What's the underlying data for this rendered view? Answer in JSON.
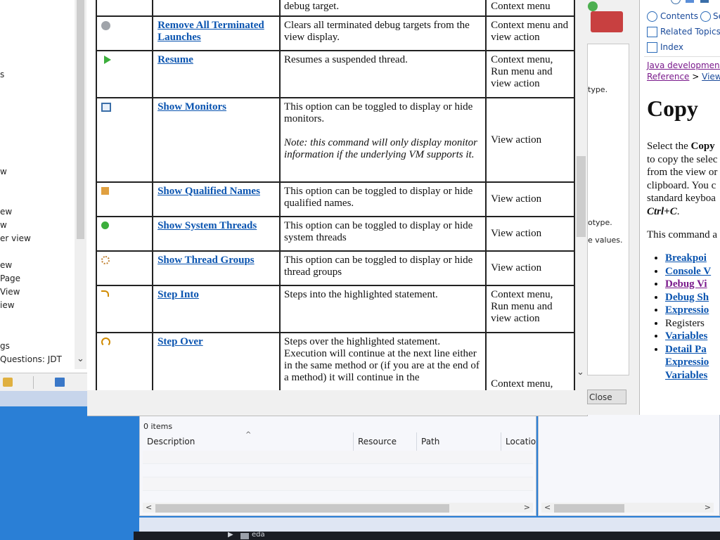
{
  "left_nav": {
    "items": [
      {
        "label": "s"
      },
      {
        "label": "w"
      },
      {
        "label": "ew"
      },
      {
        "label": "w"
      },
      {
        "label": "er view"
      },
      {
        "label": "ew"
      },
      {
        "label": " Page"
      },
      {
        "label": " View"
      },
      {
        "label": "iew"
      },
      {
        "label": "gs"
      },
      {
        "label": "Questions: JDT"
      }
    ]
  },
  "help_table": {
    "rows": [
      {
        "name": "",
        "desc": "debug target.",
        "loc": "Context menu",
        "icon": "launch-icon"
      },
      {
        "name": "Remove All Terminated Launches",
        "desc": "Clears all terminated debug targets from the view display.",
        "loc": "Context menu and view action",
        "icon": "remove-all-icon"
      },
      {
        "name": "Resume",
        "desc": "Resumes a suspended thread.",
        "loc": "Context menu, Run menu and view action",
        "icon": "resume-icon"
      },
      {
        "name": "Show Monitors",
        "desc": "This option can be toggled to display or hide monitors.",
        "note": "Note: this command will only display monitor information if the underlying VM supports it.",
        "loc": "View action",
        "icon": "monitors-icon"
      },
      {
        "name": "Show Qualified Names",
        "desc": "This option can be toggled to display or hide qualified names.",
        "loc": "View action",
        "icon": "qualified-names-icon"
      },
      {
        "name": "Show System Threads",
        "desc": "This option can be toggled to display or hide system threads",
        "loc": "View action",
        "icon": "system-threads-icon"
      },
      {
        "name": "Show Thread Groups",
        "desc": "This option can be toggled to display or hide thread groups",
        "loc": "View action",
        "icon": "thread-groups-icon"
      },
      {
        "name": "Step Into",
        "desc": "Steps into the highlighted statement.",
        "loc": "Context menu, Run menu and view action",
        "icon": "step-into-icon"
      },
      {
        "name": "Step Over",
        "desc": "Steps over the highlighted statement. Execution will continue at the next line either in the same method or (if you are at the end of a method) it will continue in the",
        "loc": "Context menu,",
        "icon": "step-over-icon"
      }
    ]
  },
  "dialog": {
    "texts": [
      "type.",
      "otype.",
      "e values."
    ],
    "close_label": "Close"
  },
  "help_panel": {
    "toolbar": {
      "contents": "Contents",
      "search": "Se",
      "related": "Related Topics",
      "index": "Index"
    },
    "breadcrumb": {
      "line1": "Java development u",
      "ref": "Reference",
      "sep1": " > ",
      "views": "Views",
      "sep2": " >"
    },
    "title": "Copy",
    "para1": [
      "Select the ",
      "Copy",
      "to copy the selec",
      "from the view or",
      "clipboard. You c",
      "standard keyboa",
      "Ctrl+C",
      "."
    ],
    "para2": "This command a",
    "links": [
      "Breakpoi",
      "Console V",
      "Debug Vi",
      "Debug Sh",
      "Expressio",
      "Registers",
      "Variables",
      "Detail Pa",
      "Expressio",
      "Variables"
    ]
  },
  "problems": {
    "count": "0 items",
    "columns": [
      "Description",
      "Resource",
      "Path",
      "Locatio"
    ]
  },
  "taskbar": {
    "label": "eda"
  }
}
